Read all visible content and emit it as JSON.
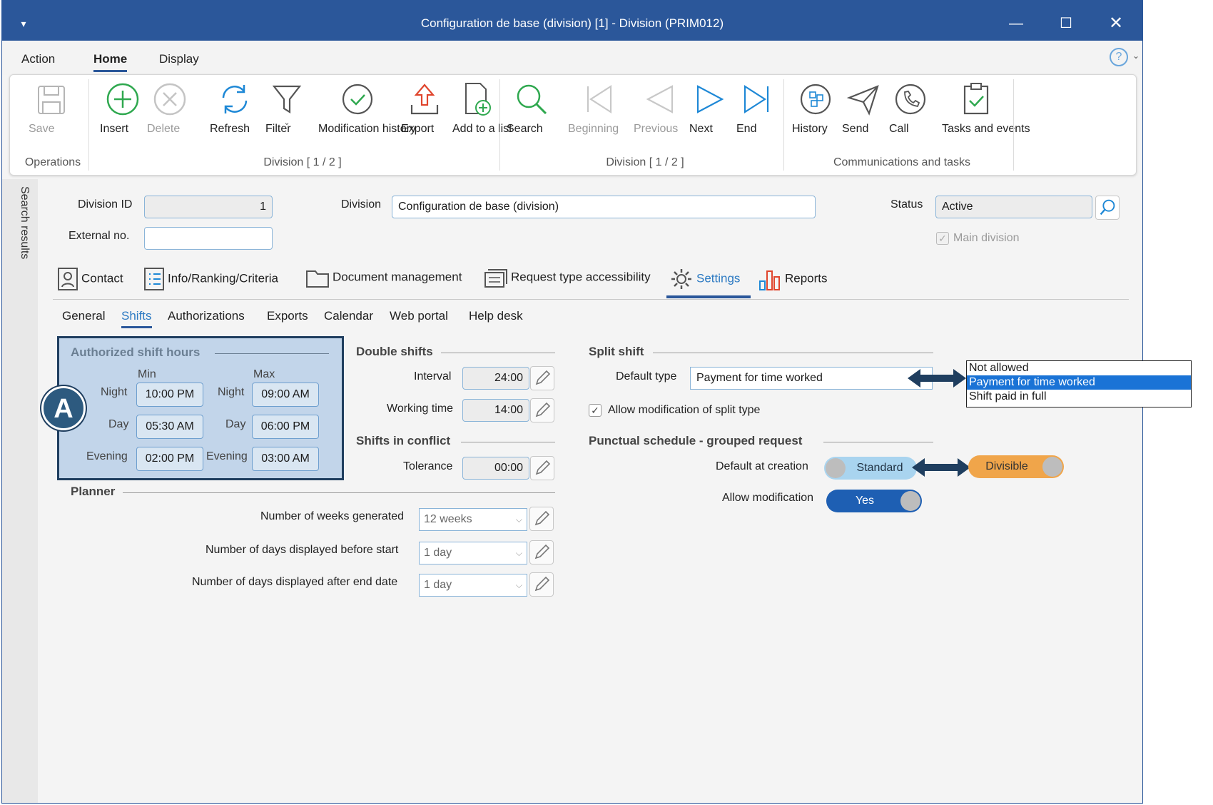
{
  "window": {
    "title": "Configuration de base (division) [1] - Division (PRIM012)"
  },
  "menu": {
    "items": [
      "Action",
      "Home",
      "Display"
    ]
  },
  "ribbon": {
    "save": "Save",
    "insert": "Insert",
    "delete": "Delete",
    "refresh": "Refresh",
    "filter": "Filter",
    "modification_history": "Modification history",
    "export": "Export",
    "add_to_list": "Add to a list",
    "search": "Search",
    "beginning": "Beginning",
    "previous": "Previous",
    "next": "Next",
    "end": "End",
    "history": "History",
    "send": "Send",
    "call": "Call",
    "tasks_events": "Tasks and events",
    "groups": {
      "operations": "Operations",
      "division1": "Division [ 1 / 2 ]",
      "division2": "Division [ 1 / 2 ]",
      "comms": "Communications and tasks"
    }
  },
  "sidebar": {
    "label": "Search results"
  },
  "form": {
    "division_id_label": "Division ID",
    "division_id": "1",
    "external_no_label": "External no.",
    "external_no": "",
    "division_label": "Division",
    "division": "Configuration de base (division)",
    "status_label": "Status",
    "status": "Active",
    "main_division": "Main division"
  },
  "tabs": [
    "Contact",
    "Info/Ranking/Criteria",
    "Document management",
    "Request type accessibility",
    "Settings",
    "Reports"
  ],
  "subtabs": [
    "General",
    "Shifts",
    "Authorizations",
    "Exports",
    "Calendar",
    "Web portal",
    "Help desk"
  ],
  "shift_hours": {
    "title": "Authorized shift hours",
    "min": "Min",
    "max": "Max",
    "night": "Night",
    "day": "Day",
    "evening": "Evening",
    "min_night": "10:00 PM",
    "min_day": "05:30 AM",
    "min_evening": "02:00 PM",
    "max_night": "09:00 AM",
    "max_day": "06:00 PM",
    "max_evening": "03:00 AM",
    "badge": "A"
  },
  "double_shifts": {
    "title": "Double shifts",
    "interval_label": "Interval",
    "interval": "24:00",
    "working_label": "Working time",
    "working": "14:00"
  },
  "conflict": {
    "title": "Shifts in conflict",
    "tolerance_label": "Tolerance",
    "tolerance": "00:00"
  },
  "planner": {
    "title": "Planner",
    "weeks_label": "Number of weeks generated",
    "weeks": "12 weeks",
    "before_label": "Number of days displayed before start",
    "before": "1 day",
    "after_label": "Number of days displayed after end date",
    "after": "1 day"
  },
  "split_shift": {
    "title": "Split shift",
    "default_type_label": "Default type",
    "default_type": "Payment for time worked",
    "allow_mod": "Allow modification of split type",
    "options": [
      "Not allowed",
      "Payment for time worked",
      "Shift paid in full"
    ]
  },
  "punctual": {
    "title": "Punctual schedule - grouped request",
    "default_label": "Default at creation",
    "standard": "Standard",
    "divisible": "Divisible",
    "allow_label": "Allow modification",
    "yes": "Yes"
  },
  "colors": {
    "accent": "#2b579a",
    "highlight_box": "#c2d5ea",
    "arrow": "#1f3e5f",
    "divisible": "#f0a54a"
  }
}
